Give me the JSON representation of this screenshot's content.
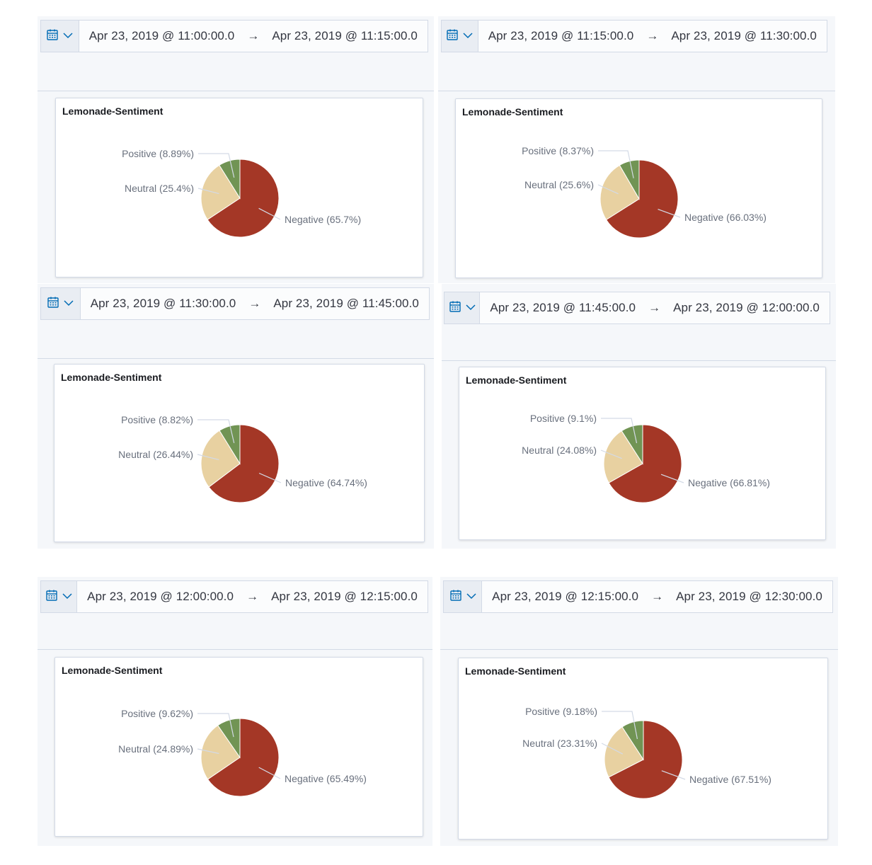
{
  "colors": {
    "negative": "#a43726",
    "neutral": "#e8d1a1",
    "positive": "#719454",
    "accent": "#006bb4"
  },
  "icons": {
    "calendar": "calendar-icon",
    "chevron": "chevron-down-icon",
    "arrow": "arrow-right-icon"
  },
  "panels": [
    {
      "start": "Apr 23, 2019 @ 11:00:00.0",
      "arrow": "→",
      "end": "Apr 23, 2019 @ 11:15:00.0",
      "title": "Lemonade-Sentiment"
    },
    {
      "start": "Apr 23, 2019 @ 11:15:00.0",
      "arrow": "→",
      "end": "Apr 23, 2019 @ 11:30:00.0",
      "title": "Lemonade-Sentiment"
    },
    {
      "start": "Apr 23, 2019 @ 11:30:00.0",
      "arrow": "→",
      "end": "Apr 23, 2019 @ 11:45:00.0",
      "title": "Lemonade-Sentiment"
    },
    {
      "start": "Apr 23, 2019 @ 11:45:00.0",
      "arrow": "→",
      "end": "Apr 23, 2019 @ 12:00:00.0",
      "title": "Lemonade-Sentiment"
    },
    {
      "start": "Apr 23, 2019 @ 12:00:00.0",
      "arrow": "→",
      "end": "Apr 23, 2019 @ 12:15:00.0",
      "title": "Lemonade-Sentiment"
    },
    {
      "start": "Apr 23, 2019 @ 12:15:00.0",
      "arrow": "→",
      "end": "Apr 23, 2019 @ 12:30:00.0",
      "title": "Lemonade-Sentiment"
    }
  ],
  "chart_data": [
    {
      "type": "pie",
      "title": "Lemonade-Sentiment",
      "categories": [
        "Negative",
        "Neutral",
        "Positive"
      ],
      "values": [
        65.7,
        25.4,
        8.89
      ],
      "labels": [
        "Negative (65.7%)",
        "Neutral (25.4%)",
        "Positive (8.89%)"
      ]
    },
    {
      "type": "pie",
      "title": "Lemonade-Sentiment",
      "categories": [
        "Negative",
        "Neutral",
        "Positive"
      ],
      "values": [
        66.03,
        25.6,
        8.37
      ],
      "labels": [
        "Negative (66.03%)",
        "Neutral (25.6%)",
        "Positive (8.37%)"
      ]
    },
    {
      "type": "pie",
      "title": "Lemonade-Sentiment",
      "categories": [
        "Negative",
        "Neutral",
        "Positive"
      ],
      "values": [
        64.74,
        26.44,
        8.82
      ],
      "labels": [
        "Negative (64.74%)",
        "Neutral (26.44%)",
        "Positive (8.82%)"
      ]
    },
    {
      "type": "pie",
      "title": "Lemonade-Sentiment",
      "categories": [
        "Negative",
        "Neutral",
        "Positive"
      ],
      "values": [
        66.81,
        24.08,
        9.1
      ],
      "labels": [
        "Negative (66.81%)",
        "Neutral (24.08%)",
        "Positive (9.1%)"
      ]
    },
    {
      "type": "pie",
      "title": "Lemonade-Sentiment",
      "categories": [
        "Negative",
        "Neutral",
        "Positive"
      ],
      "values": [
        65.49,
        24.89,
        9.62
      ],
      "labels": [
        "Negative (65.49%)",
        "Neutral (24.89%)",
        "Positive (9.62%)"
      ]
    },
    {
      "type": "pie",
      "title": "Lemonade-Sentiment",
      "categories": [
        "Negative",
        "Neutral",
        "Positive"
      ],
      "values": [
        67.51,
        23.31,
        9.18
      ],
      "labels": [
        "Negative (67.51%)",
        "Neutral (23.31%)",
        "Positive (9.18%)"
      ]
    }
  ]
}
